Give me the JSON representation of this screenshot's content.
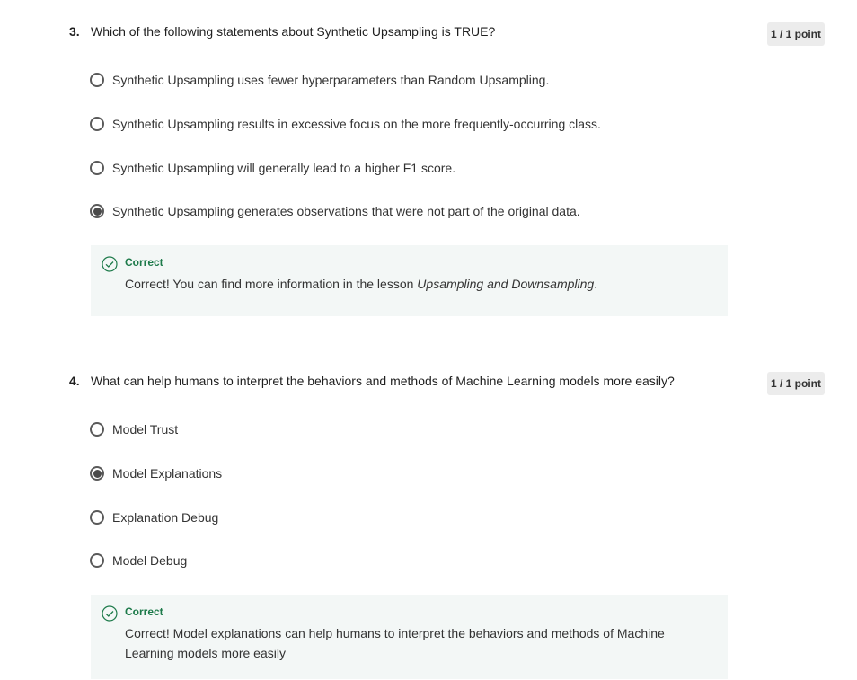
{
  "questions": [
    {
      "number": "3.",
      "text": "Which of the following statements about Synthetic Upsampling is TRUE?",
      "points": "1 / 1 point",
      "options": [
        {
          "label": "Synthetic Upsampling uses fewer hyperparameters than Random Upsampling.",
          "selected": false
        },
        {
          "label": "Synthetic Upsampling results in excessive focus on the more frequently-occurring class.",
          "selected": false
        },
        {
          "label": "Synthetic Upsampling will generally lead to a higher F1 score.",
          "selected": false
        },
        {
          "label": "Synthetic Upsampling generates observations that were not part of the original data.",
          "selected": true
        }
      ],
      "feedback": {
        "title": "Correct",
        "text": "Correct! You can find more information in the lesson ",
        "lesson": "Upsampling and Downsampling",
        "suffix": "."
      }
    },
    {
      "number": "4.",
      "text": "What can help humans to interpret the behaviors and methods of Machine Learning models more easily?",
      "points": "1 / 1 point",
      "options": [
        {
          "label": "Model Trust",
          "selected": false
        },
        {
          "label": "Model Explanations",
          "selected": true
        },
        {
          "label": "Explanation Debug",
          "selected": false
        },
        {
          "label": "Model Debug",
          "selected": false
        }
      ],
      "feedback": {
        "title": "Correct",
        "text": "Correct! Model explanations can help humans to interpret the behaviors and methods of Machine Learning models more easily"
      }
    }
  ],
  "colors": {
    "correct": "#1d7a4a",
    "feedback_bg": "#f3f7f6",
    "badge_bg": "#ececec"
  },
  "icons": {
    "feedback": "check-circle-icon",
    "radio": "radio-icon"
  }
}
